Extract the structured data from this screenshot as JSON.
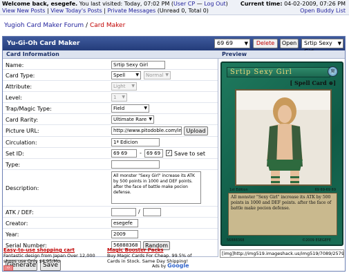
{
  "topbar": {
    "welcome": "Welcome back, esegefe.",
    "last_visited": "You last visited: Today, 07:02 PM",
    "user_cp": "User CP",
    "logout": "Log Out",
    "view_new_posts": "View New Posts",
    "view_todays_posts": "View Today's Posts",
    "private_messages": "Private Messages",
    "pm_counts": "(Unread 0, Total 0)",
    "current_time_label": "Current time:",
    "current_time": "04-02-2009, 07:26 PM",
    "open_buddy_list": "Open Buddy List"
  },
  "breadcrumb": {
    "forum": "Yugioh Card Maker Forum",
    "separator": "/",
    "current": "Card Maker"
  },
  "header": {
    "title": "Yu-Gi-Oh Card Maker",
    "saved_select": "69 69",
    "delete": "Delete",
    "open": "Open",
    "card_select": "Srtip Sexy Girl"
  },
  "sections": {
    "info": "Card Information",
    "preview": "Preview"
  },
  "form": {
    "name_label": "Name:",
    "name_value": "Srtip Sexy Girl",
    "card_type_label": "Card Type:",
    "card_type_value": "Spell",
    "card_type_sub": "Normal",
    "attribute_label": "Attribute:",
    "attribute_value": "Light",
    "level_label": "Level:",
    "level_value": "1",
    "trap_magic_label": "Trap/Magic Type:",
    "trap_magic_value": "Field",
    "rarity_label": "Card Rarity:",
    "rarity_value": "Ultimate Rare",
    "picture_url_label": "Picture URL:",
    "picture_url_value": "http://www.pitodoble.com/imag",
    "upload": "Upload",
    "circulation_label": "Circulation:",
    "circulation_value": "1ª Edicion",
    "set_id_label": "Set ID:",
    "set_id_a": "69 69",
    "set_id_dash": "-",
    "set_id_b": "69 69",
    "save_to_set": "Save to set",
    "type_label": "Type:",
    "description_label": "Description:",
    "description_value": "All monster \"Sexy Girl\" increase its ATK by 500 points in 1000 and DEF points. after the face of battle make pocion defense.",
    "atk_def_label": "ATK / DEF:",
    "atk_slash": "/",
    "creator_label": "Creator:",
    "creator_value": "esegefe",
    "year_label": "Year:",
    "year_value": "2009",
    "serial_label": "Serial Number:",
    "serial_value": "56888368",
    "random": "Random",
    "generate": "Generate",
    "save": "Save"
  },
  "card": {
    "name": "Srtip Sexy Girl",
    "type_line": "[ Spell Card ",
    "type_close": "]",
    "edition": "1st Edition",
    "set_id": "69 69-69 69",
    "description": "All monster \"Sexy Girl\" increase its ATK by 500 points in 1000 and DEF points. after the face of battle make pocion defense.",
    "serial": "56888368",
    "copyright": "©2009 ESEGEFE"
  },
  "image_code": "[img]http://img519.imageshack.us/img519/7089/257961",
  "ads": {
    "ad1_title": "Easy-to-use shopping cart",
    "ad1_text": "Fantastic design from Japan Over 12,000 shops use Only $4.95/Mo",
    "ad2_title": "Magic Booster Packs",
    "ad2_text": "Buy Magic Cards For Cheap. 99.5% of Cards in Stock. Same Day Shipping!",
    "ads_by": "Ads by",
    "google": "Google"
  }
}
